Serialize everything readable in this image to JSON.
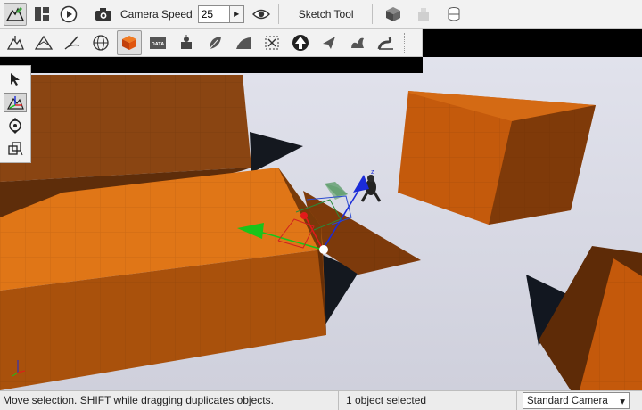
{
  "toolbar_top": {
    "camera_speed_label": "Camera Speed",
    "camera_speed_value": "25",
    "sketch_tool_label": "Sketch Tool",
    "icons": [
      "edit-mode-icon",
      "layout-icon",
      "play-icon",
      "camera-icon",
      "spin-arrow-icon",
      "eye-icon",
      "cube-icon",
      "box-icon",
      "cylinder-icon"
    ]
  },
  "toolbar_tools": {
    "icons": [
      "terrain-raise-icon",
      "terrain-mountain-icon",
      "terrain-paint-icon",
      "globe-icon",
      "cube-brush-icon",
      "data-icon",
      "robot-icon",
      "leaf-icon",
      "ramp-icon",
      "selection-frame-icon",
      "up-arrow-icon",
      "star-shape-icon",
      "tree-icon",
      "road-icon"
    ],
    "active_index": 4,
    "data_label": "DATA"
  },
  "palette": {
    "items": [
      "pointer-icon",
      "move-gizmo-icon",
      "rotate-icon",
      "scale-icon"
    ],
    "active_index": 1
  },
  "gizmo": {
    "axis_z_label": "z"
  },
  "statusbar": {
    "message": "Move selection.  SHIFT while dragging duplicates objects.",
    "selection": "1 object selected",
    "camera_mode": "Standard Camera"
  },
  "colors": {
    "block_orange": "#d9670a",
    "block_top": "#e07617",
    "block_shadow": "#6b3208",
    "ground": "#d2d3df",
    "sky": "#000000",
    "gizmo_x": "#e21a1a",
    "gizmo_y": "#19c41a",
    "gizmo_z": "#1b2bd8"
  }
}
